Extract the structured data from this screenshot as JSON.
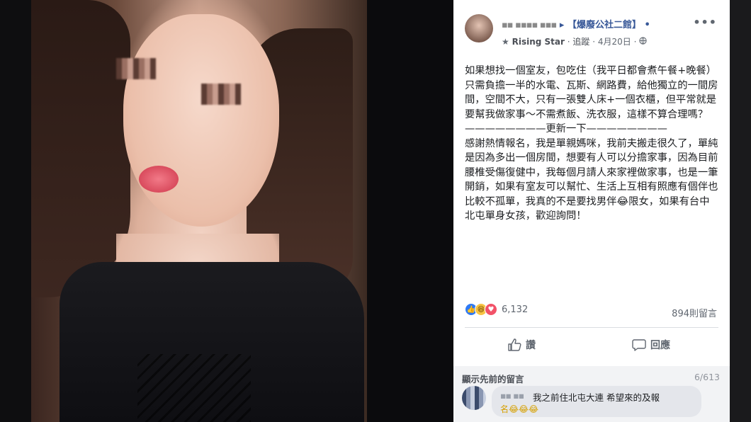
{
  "post": {
    "author_blur": "▪▪ ▪▪▪▪ ▪▪▪",
    "arrow": "▸",
    "group_name": "【爆廢公社二館】",
    "badge_icon": "★",
    "badge_text": "Rising Star",
    "follow_label": "追蹤",
    "date": "4月20日",
    "more": "•••",
    "body": "如果想找一個室友，包吃住（我平日都會煮午餐+晚餐）只需負擔一半的水電、瓦斯、網路費，給他獨立的一間房間，空間不大，只有一張雙人床+一個衣櫃，但平常就是要幫我做家事～不需煮飯、洗衣服，這樣不算合理嗎？\n————————更新一下————————\n感謝熱情報名，我是單親媽咪，我前夫搬走很久了，單純是因為多出一個房間，想要有人可以分擔家事，因為目前腰椎受傷復健中，我每個月請人來家裡做家事，也是一筆開銷，如果有室友可以幫忙、生活上互相有照應有個伴也比較不孤單，我真的不是要找男伴😂限女，如果有台中北屯單身女孩，歡迎詢問！",
    "reaction_count": "6,132",
    "comment_count": "894則留言",
    "like_label": "讚",
    "reply_label": "回應"
  },
  "comments": {
    "header_label": "顯示先前的留言",
    "pager": "6/613",
    "first": {
      "name_blur": "▪▪ ▪▪",
      "text": "我之前住北屯大連 希望來的及報",
      "emoji": "名😂😂😂"
    }
  },
  "colors": {
    "link": "#385898",
    "like": "#2e7af5",
    "love": "#f25268",
    "haha": "#f7c444"
  }
}
